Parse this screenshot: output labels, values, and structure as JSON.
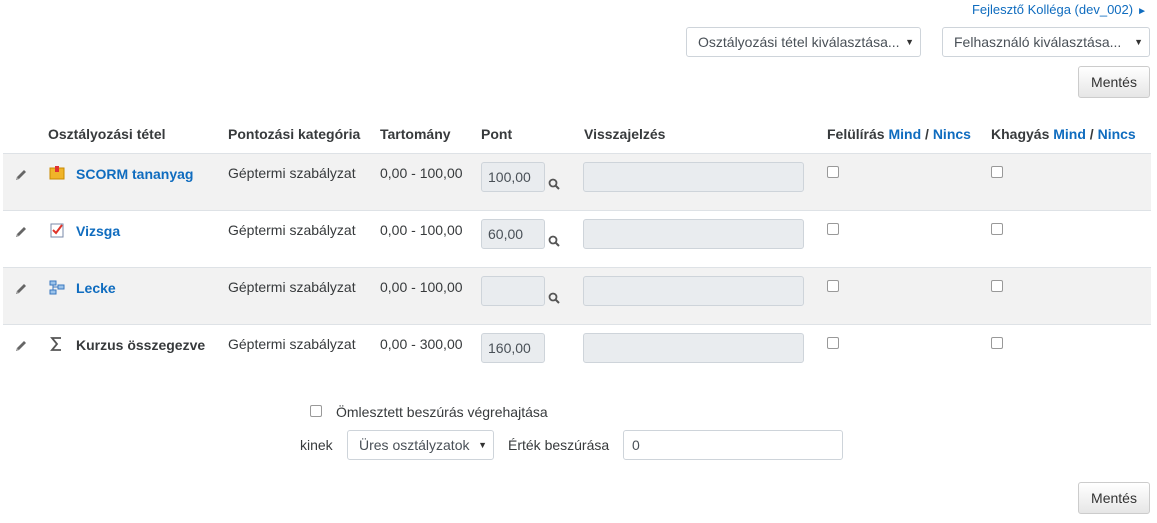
{
  "user_link": {
    "label": "Fejlesztő Kolléga (dev_002)",
    "arrow": "►"
  },
  "selects": {
    "grade_item": "Osztályozási tétel kiválasztása...",
    "user": "Felhasználó kiválasztása...",
    "caret": "▼"
  },
  "buttons": {
    "save_top": "Mentés",
    "save_bottom": "Mentés"
  },
  "table": {
    "headers": {
      "item": "Osztályozási tétel",
      "category": "Pontozási kategória",
      "range": "Tartomány",
      "grade": "Pont",
      "feedback": "Visszajelzés",
      "override": "Felülírás",
      "exclude": "Khagyás",
      "all": "Mind",
      "separator": "/",
      "none": "Nincs"
    },
    "rows": [
      {
        "icon": "scorm-package-icon",
        "name": "SCORM tananyag",
        "category": "Géptermi szabályzat",
        "range": "0,00 - 100,00",
        "grade": "100,00"
      },
      {
        "icon": "quiz-icon",
        "name": "Vizsga",
        "category": "Géptermi szabályzat",
        "range": "0,00 - 100,00",
        "grade": "60,00"
      },
      {
        "icon": "lesson-icon",
        "name": "Lecke",
        "category": "Géptermi szabályzat",
        "range": "0,00 - 100,00",
        "grade": ""
      },
      {
        "icon": "sigma-icon",
        "name": "Kurzus összegezve",
        "category": "Géptermi szabályzat",
        "range": "0,00 - 300,00",
        "grade": "160,00"
      }
    ]
  },
  "bulk": {
    "checkbox_label": "Ömlesztett beszúrás végrehajtása",
    "kinek_label": "kinek",
    "kinek_value": "Üres osztályzatok",
    "insert_label": "Érték beszúrása",
    "insert_value": "0"
  }
}
